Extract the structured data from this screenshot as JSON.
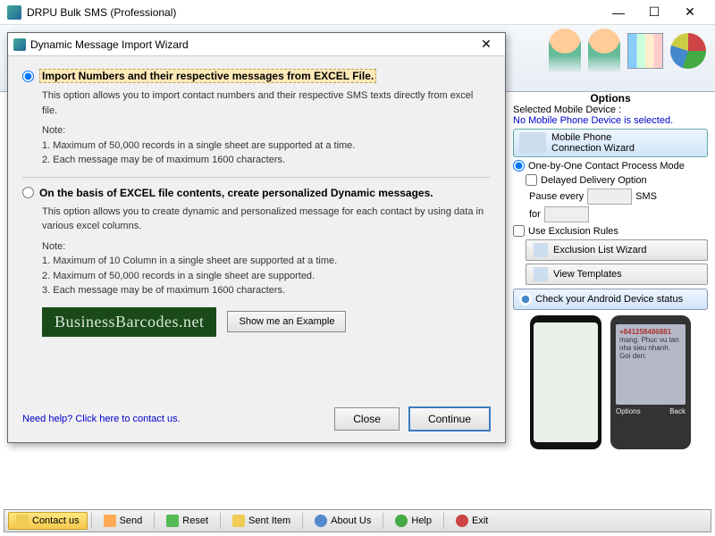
{
  "app": {
    "title": "DRPU Bulk SMS (Professional)"
  },
  "dialog": {
    "title": "Dynamic Message Import Wizard",
    "opt1": {
      "label": "Import Numbers and their respective messages from EXCEL File.",
      "desc": "This option allows you to import contact numbers and their respective SMS texts directly from excel file.",
      "note_hdr": "Note:",
      "note1": "1. Maximum of 50,000 records in a single sheet are supported at a time.",
      "note2": "2. Each message may be of maximum 1600 characters."
    },
    "opt2": {
      "label": "On the basis of EXCEL file contents, create personalized Dynamic messages.",
      "desc": "This option allows you to create dynamic and personalized message for each contact by using data in various excel columns.",
      "note_hdr": "Note:",
      "note1": "1. Maximum of 10 Column in a single sheet are supported at a time.",
      "note2": "2. Maximum of 50,000 records in a single sheet are supported.",
      "note3": "3. Each message may be of maximum 1600 characters."
    },
    "banner": "BusinessBarcodes.net",
    "example_btn": "Show me an Example",
    "help_link": "Need help? Click here to contact us.",
    "close_btn": "Close",
    "continue_btn": "Continue"
  },
  "options": {
    "title": "Options",
    "sel_label": "Selected Mobile Device :",
    "no_device": "No Mobile Phone Device is selected.",
    "wizard_l1": "Mobile Phone",
    "wizard_l2": "Connection  Wizard",
    "mode": "One-by-One Contact Process Mode",
    "delayed": "Delayed Delivery Option",
    "pause": "Pause every",
    "sms": "SMS",
    "for": "for",
    "exclusion": "Use Exclusion Rules",
    "excl_btn": "Exclusion List Wizard",
    "templates_btn": "View Templates",
    "status_btn": "Check your Android Device status"
  },
  "phones": {
    "p2_num": "+841258486881",
    "p2_text": "mang. Phuc vu tan nha sieu nhanh. Goi den:",
    "p2_opts": "Options",
    "p2_back": "Back"
  },
  "bottombar": {
    "contact": "Contact us",
    "send": "Send",
    "reset": "Reset",
    "sent": "Sent Item",
    "about": "About Us",
    "help": "Help",
    "exit": "Exit"
  }
}
